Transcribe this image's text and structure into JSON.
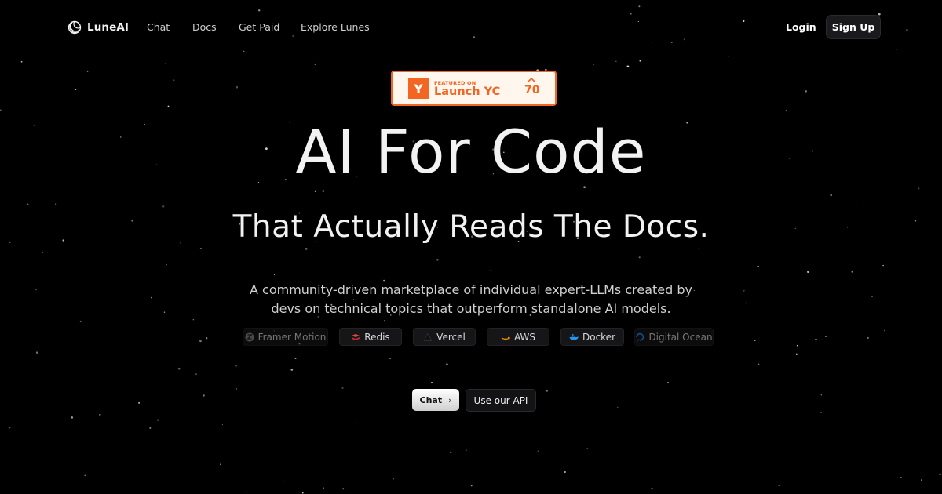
{
  "nav": {
    "brand": "LuneAI",
    "links": [
      "Chat",
      "Docs",
      "Get Paid",
      "Explore Lunes"
    ],
    "login": "Login",
    "signup": "Sign Up"
  },
  "yc_badge": {
    "logo_letter": "Y",
    "featured": "FEATURED ON",
    "title": "Launch YC",
    "upvotes": "70",
    "color": "#f26522"
  },
  "hero": {
    "headline": "AI For Code",
    "subheadline": "That Actually Reads The Docs.",
    "description": "A community-driven marketplace of individual expert-LLMs created by devs on technical topics that outperform standalone AI models."
  },
  "tech_chips": [
    {
      "label": "Framer Motion",
      "icon": "framer-motion-icon"
    },
    {
      "label": "Redis",
      "icon": "redis-icon"
    },
    {
      "label": "Vercel",
      "icon": "vercel-icon"
    },
    {
      "label": "AWS",
      "icon": "aws-icon"
    },
    {
      "label": "Docker",
      "icon": "docker-icon"
    },
    {
      "label": "Digital Ocean",
      "icon": "digital-ocean-icon"
    }
  ],
  "cta": {
    "chat": "Chat",
    "api": "Use our API"
  }
}
